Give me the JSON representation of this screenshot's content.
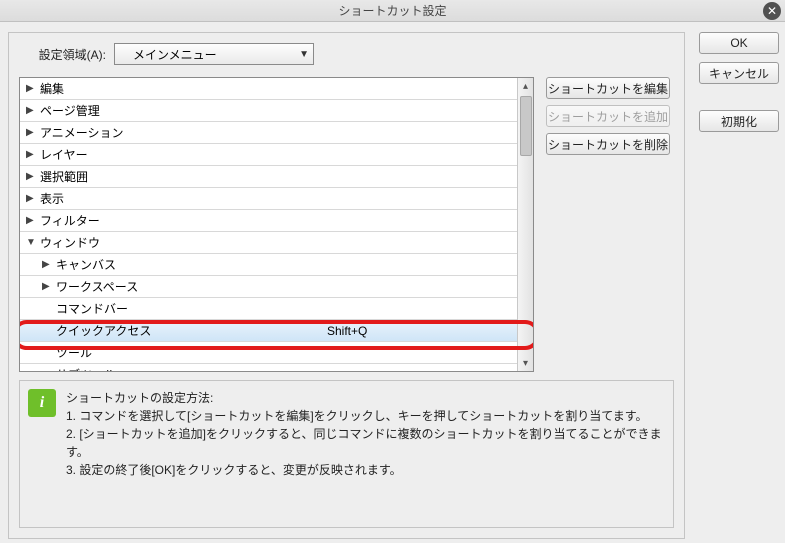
{
  "title": "ショートカット設定",
  "buttons": {
    "ok": "OK",
    "cancel": "キャンセル",
    "reset": "初期化",
    "edit": "ショートカットを編集",
    "add": "ショートカットを追加",
    "delete": "ショートカットを削除"
  },
  "scope": {
    "label": "設定領域(A):",
    "value": "メインメニュー"
  },
  "tree": {
    "rows": [
      {
        "label": "編集",
        "arrow": "right",
        "level": 0,
        "shortcut": ""
      },
      {
        "label": "ページ管理",
        "arrow": "right",
        "level": 0,
        "shortcut": ""
      },
      {
        "label": "アニメーション",
        "arrow": "right",
        "level": 0,
        "shortcut": ""
      },
      {
        "label": "レイヤー",
        "arrow": "right",
        "level": 0,
        "shortcut": ""
      },
      {
        "label": "選択範囲",
        "arrow": "right",
        "level": 0,
        "shortcut": ""
      },
      {
        "label": "表示",
        "arrow": "right",
        "level": 0,
        "shortcut": ""
      },
      {
        "label": "フィルター",
        "arrow": "right",
        "level": 0,
        "shortcut": ""
      },
      {
        "label": "ウィンドウ",
        "arrow": "down",
        "level": 0,
        "shortcut": ""
      },
      {
        "label": "キャンバス",
        "arrow": "right",
        "level": 1,
        "shortcut": ""
      },
      {
        "label": "ワークスペース",
        "arrow": "right",
        "level": 1,
        "shortcut": ""
      },
      {
        "label": "コマンドバー",
        "arrow": "",
        "level": 1,
        "shortcut": ""
      },
      {
        "label": "クイックアクセス",
        "arrow": "",
        "level": 1,
        "shortcut": "Shift+Q",
        "selected": true
      },
      {
        "label": "ツール",
        "arrow": "",
        "level": 1,
        "shortcut": ""
      },
      {
        "label": "サブツール",
        "arrow": "",
        "level": 1,
        "shortcut": ""
      }
    ]
  },
  "info": {
    "heading": "ショートカットの設定方法:",
    "line1": "1. コマンドを選択して[ショートカットを編集]をクリックし、キーを押してショートカットを割り当てます。",
    "line2": "2. [ショートカットを追加]をクリックすると、同じコマンドに複数のショートカットを割り当てることができます。",
    "line3": "3. 設定の終了後[OK]をクリックすると、変更が反映されます。"
  }
}
